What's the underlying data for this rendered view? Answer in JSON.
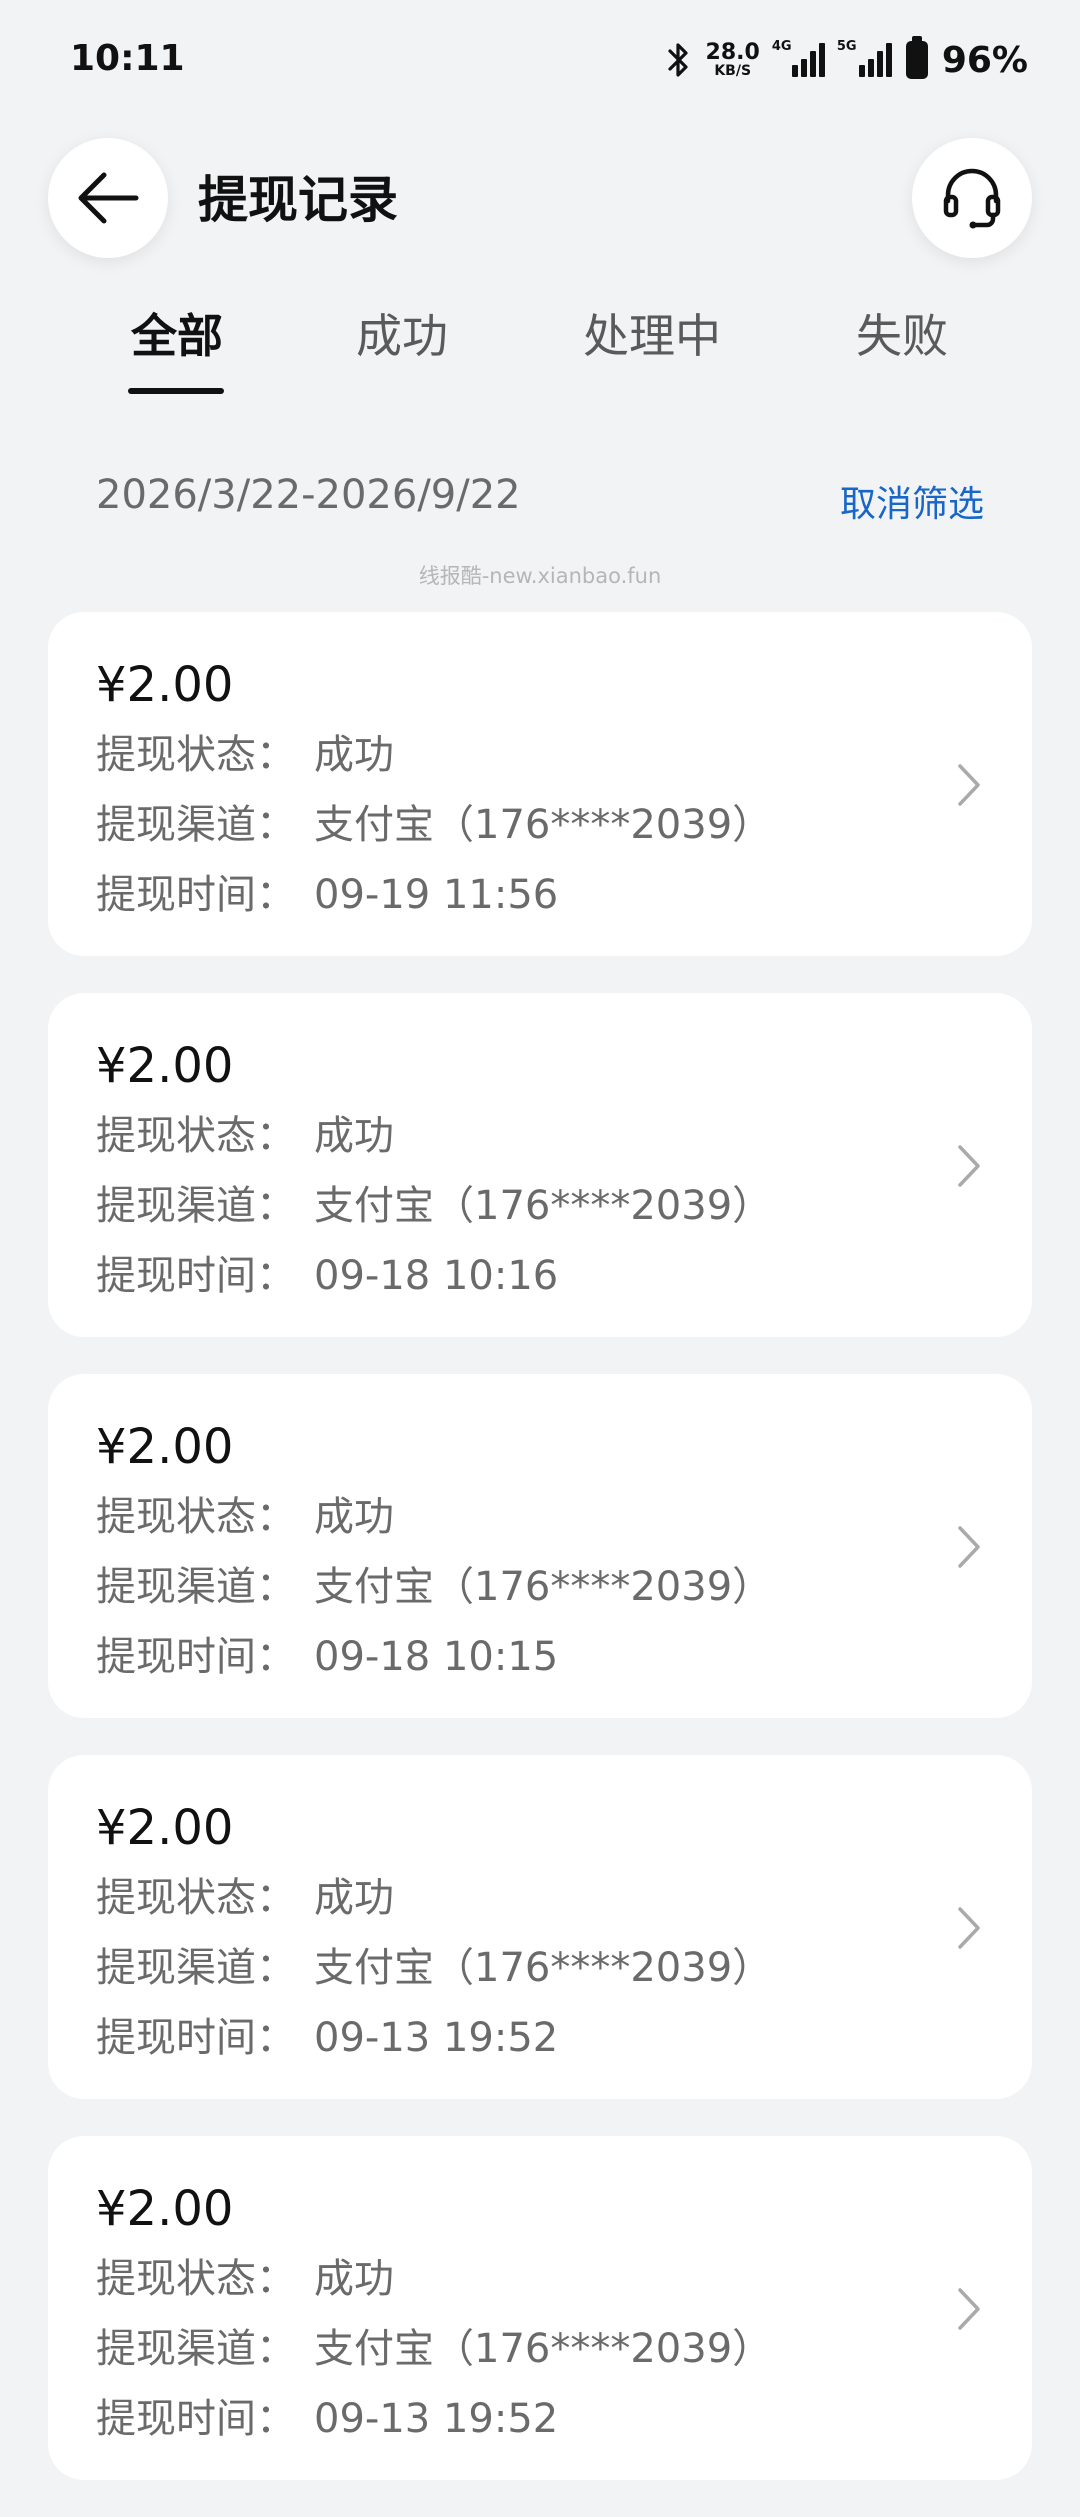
{
  "status_bar": {
    "time": "10:11",
    "net_speed_value": "28.0",
    "net_speed_unit": "KB/S",
    "signal1_tag": "4G",
    "signal2_tag": "5G",
    "battery": "96%"
  },
  "header": {
    "title": "提现记录"
  },
  "tabs": [
    {
      "label": "全部"
    },
    {
      "label": "成功"
    },
    {
      "label": "处理中"
    },
    {
      "label": "失败"
    }
  ],
  "filter": {
    "date_range": "2026/3/22-2026/9/22",
    "cancel_label": "取消筛选"
  },
  "watermark": "线报酷-new.xianbao.fun",
  "labels": {
    "status": "提现状态：",
    "channel": "提现渠道：",
    "time": "提现时间："
  },
  "records": [
    {
      "amount": "¥2.00",
      "status": "成功",
      "channel": "支付宝（176****2039）",
      "time": "09-19 11:56"
    },
    {
      "amount": "¥2.00",
      "status": "成功",
      "channel": "支付宝（176****2039）",
      "time": "09-18 10:16"
    },
    {
      "amount": "¥2.00",
      "status": "成功",
      "channel": "支付宝（176****2039）",
      "time": "09-18 10:15"
    },
    {
      "amount": "¥2.00",
      "status": "成功",
      "channel": "支付宝（176****2039）",
      "time": "09-13 19:52"
    },
    {
      "amount": "¥2.00",
      "status": "成功",
      "channel": "支付宝（176****2039）",
      "time": "09-13 19:52"
    }
  ],
  "colors": {
    "accent": "#1766c8",
    "background": "#f1f3f5",
    "card": "#ffffff"
  }
}
